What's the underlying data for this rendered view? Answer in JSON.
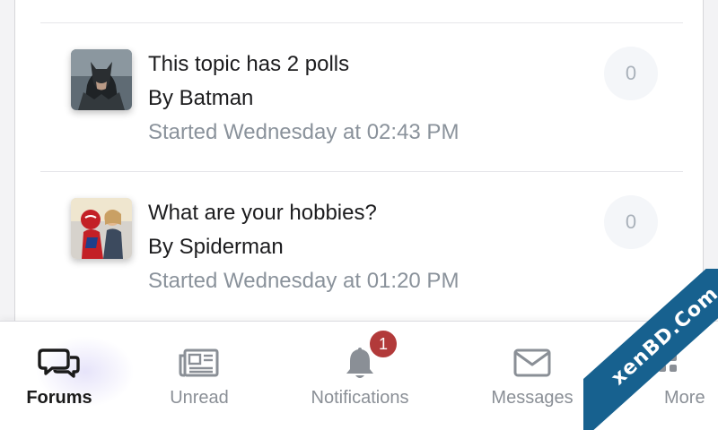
{
  "threads": [
    {
      "title": "This topic has 2 polls",
      "author": "By Batman",
      "meta": "Started Wednesday at 02:43 PM",
      "replies": "0",
      "avatar_icon": "batman-avatar"
    },
    {
      "title": "What are your hobbies?",
      "author": "By Spiderman",
      "meta": "Started Wednesday at 01:20 PM",
      "replies": "0",
      "avatar_icon": "spiderman-avatar"
    }
  ],
  "tabbar": {
    "tabs": [
      {
        "label": "Forums",
        "icon": "chat-bubbles-icon",
        "active": true
      },
      {
        "label": "Unread",
        "icon": "newspaper-icon",
        "active": false
      },
      {
        "label": "Notifications",
        "icon": "bell-icon",
        "active": false,
        "badge": "1"
      },
      {
        "label": "Messages",
        "icon": "envelope-icon",
        "active": false
      },
      {
        "label": "More",
        "icon": "grid-dots-icon",
        "active": false
      }
    ]
  },
  "watermark": {
    "text": "xenBD.Com"
  },
  "colors": {
    "badge": "#b23a3a",
    "meta_text": "#8a929b",
    "watermark": "#17618f"
  }
}
